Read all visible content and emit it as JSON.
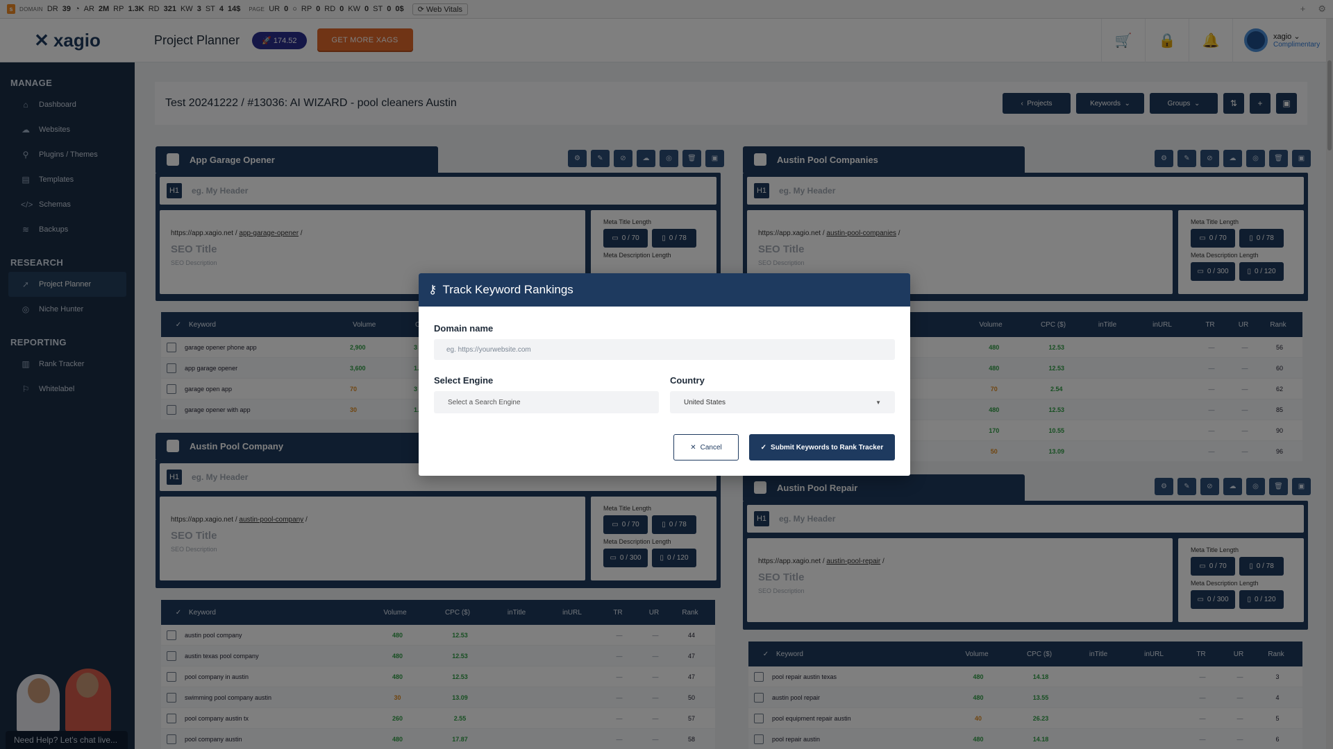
{
  "seobar": {
    "domain_label": "DOMAIN",
    "dr_label": "DR",
    "dr": "39",
    "ar_label": "AR",
    "ar": "2M",
    "rp_label": "RP",
    "rp": "1.3K",
    "rd_label": "RD",
    "rd": "321",
    "kw_label": "KW",
    "kw": "3",
    "st_label": "ST",
    "st": "4",
    "st_unit": "14$",
    "page_label": "PAGE",
    "ur_label": "UR",
    "ur": "0",
    "prp_label": "RP",
    "prp": "0",
    "prd_label": "RD",
    "prd": "0",
    "pkw_label": "KW",
    "pkw": "0",
    "pst_label": "ST",
    "pst": "0",
    "pst_unit": "0$",
    "web_vitals": "Web Vitals"
  },
  "header": {
    "brand": "xagio",
    "page_title": "Project Planner",
    "xags_balance": "174.52",
    "get_more": "GET MORE XAGS",
    "user_name": "xagio",
    "user_plan": "Complimentary"
  },
  "sidebar": {
    "manage_label": "MANAGE",
    "manage": [
      {
        "label": "Dashboard"
      },
      {
        "label": "Websites"
      },
      {
        "label": "Plugins / Themes"
      },
      {
        "label": "Templates"
      },
      {
        "label": "Schemas"
      },
      {
        "label": "Backups"
      }
    ],
    "research_label": "RESEARCH",
    "research": [
      {
        "label": "Project Planner"
      },
      {
        "label": "Niche Hunter"
      }
    ],
    "reporting_label": "REPORTING",
    "reporting": [
      {
        "label": "Rank Tracker"
      },
      {
        "label": "Whitelabel"
      }
    ],
    "help": "Need Help? Let's chat live..."
  },
  "project": {
    "title": "Test 20241222 / #13036: AI WIZARD - pool cleaners Austin",
    "projects_btn": "Projects",
    "keywords_btn": "Keywords",
    "groups_btn": "Groups"
  },
  "common": {
    "h1": "H1",
    "header_placeholder": "eg. My Header",
    "base_url": "https://app.xagio.net /",
    "seo_title": "SEO Title",
    "seo_desc": "SEO Description",
    "meta_title_len": "Meta Title Length",
    "meta_desc_len": "Meta Description Length",
    "mt_desktop": "0 / 70",
    "mt_mobile": "0 / 78",
    "md_desktop": "0 / 300",
    "md_mobile": "0 / 120",
    "col_keyword": "Keyword",
    "col_volume": "Volume",
    "col_cpc": "CPC ($)",
    "col_intitle": "inTitle",
    "col_inurl": "inURL",
    "col_tr": "TR",
    "col_ur": "UR",
    "col_rank": "Rank",
    "dash": "—"
  },
  "groups": {
    "g1": {
      "name": "App Garage Opener",
      "slug": "app-garage-opener",
      "rows": [
        {
          "kw": "garage opener phone app",
          "vol": "2,900",
          "cpc": "3",
          "vc": "g"
        },
        {
          "kw": "app garage opener",
          "vol": "3,600",
          "cpc": "1.",
          "vc": "g"
        },
        {
          "kw": "garage open app",
          "vol": "70",
          "cpc": "3",
          "vc": "o"
        },
        {
          "kw": "garage opener with app",
          "vol": "30",
          "cpc": "1.",
          "vc": "o"
        }
      ]
    },
    "g2": {
      "name": "Austin Pool Companies",
      "slug": "austin-pool-companies",
      "rows": [
        {
          "vol": "480",
          "cpc": "12.53",
          "rank": "56",
          "vc": "g"
        },
        {
          "vol": "480",
          "cpc": "12.53",
          "rank": "60",
          "vc": "g"
        },
        {
          "vol": "70",
          "cpc": "2.54",
          "rank": "62",
          "vc": "o"
        },
        {
          "vol": "480",
          "cpc": "12.53",
          "rank": "85",
          "vc": "g"
        },
        {
          "vol": "170",
          "cpc": "10.55",
          "rank": "90",
          "vc": "g"
        },
        {
          "vol": "50",
          "cpc": "13.09",
          "rank": "96",
          "vc": "o"
        }
      ]
    },
    "g3": {
      "name": "Austin Pool Company",
      "slug": "austin-pool-company",
      "rows": [
        {
          "kw": "austin pool company",
          "vol": "480",
          "cpc": "12.53",
          "rank": "44",
          "vc": "g"
        },
        {
          "kw": "austin texas pool company",
          "vol": "480",
          "cpc": "12.53",
          "rank": "47",
          "vc": "g"
        },
        {
          "kw": "pool company in austin",
          "vol": "480",
          "cpc": "12.53",
          "rank": "47",
          "vc": "g"
        },
        {
          "kw": "swimming pool company austin",
          "vol": "30",
          "cpc": "13.09",
          "rank": "50",
          "vc": "o"
        },
        {
          "kw": "pool company austin tx",
          "vol": "260",
          "cpc": "2.55",
          "rank": "57",
          "vc": "g"
        },
        {
          "kw": "pool company austin",
          "vol": "480",
          "cpc": "17.87",
          "rank": "58",
          "vc": "g"
        }
      ]
    },
    "g4": {
      "name": "Austin Pool Repair",
      "slug": "austin-pool-repair",
      "rows": [
        {
          "kw": "pool repair austin texas",
          "vol": "480",
          "cpc": "14.18",
          "rank": "3",
          "vc": "g"
        },
        {
          "kw": "austin pool repair",
          "vol": "480",
          "cpc": "13.55",
          "rank": "4",
          "vc": "g"
        },
        {
          "kw": "pool equipment repair austin",
          "vol": "40",
          "cpc": "26.23",
          "rank": "5",
          "vc": "o"
        },
        {
          "kw": "pool repair austin",
          "vol": "480",
          "cpc": "14.18",
          "rank": "6",
          "vc": "g"
        }
      ]
    }
  },
  "modal": {
    "title": "Track Keyword Rankings",
    "domain_label": "Domain name",
    "domain_placeholder": "eg. https://yourwebsite.com",
    "engine_label": "Select Engine",
    "engine_placeholder": "Select a Search Engine",
    "country_label": "Country",
    "country_value": "United States",
    "cancel": "Cancel",
    "submit": "Submit Keywords to Rank Tracker"
  }
}
